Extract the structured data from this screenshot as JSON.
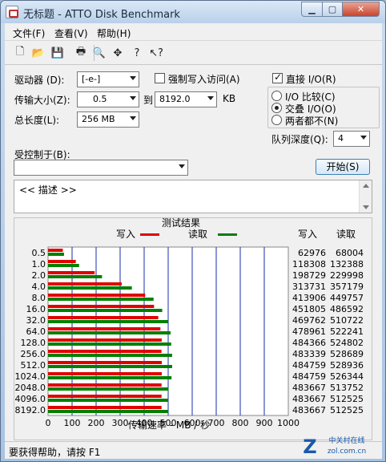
{
  "window": {
    "title": "无标题 - ATTO Disk Benchmark"
  },
  "menu": [
    {
      "label": "文件(F)"
    },
    {
      "label": "查看(V)"
    },
    {
      "label": "帮助(H)"
    }
  ],
  "toolbar": {
    "icons": [
      "new-icon",
      "open-icon",
      "save-icon",
      "print-icon",
      "print-preview-icon",
      "move-icon",
      "help-icon",
      "context-help-icon"
    ]
  },
  "form": {
    "drive_label": "驱动器 (D):",
    "drive_value": "[-e-]",
    "force_write_label": "强制写入访问(A)",
    "transfer_size_label": "传输大小(Z):",
    "transfer_from": "0.5",
    "to_label": "到",
    "transfer_to": "8192.0",
    "kb_label": "KB",
    "total_length_label": "总长度(L):",
    "total_length_value": "256 MB",
    "direct_io_label": "直接 I/O(R)",
    "io_compare_label": "I/O 比较(C)",
    "overlap_io_label": "交叠 I/O(O)",
    "neither_label": "两者都不(N)",
    "queue_depth_label": "队列深度(Q):",
    "queue_depth_value": "4",
    "controlled_by_label": "受控制于(B):",
    "controlled_by_value": "",
    "start_button": "开始(S)",
    "description": "<< 描述 >>"
  },
  "chart_data": {
    "type": "bar",
    "title": "测试结果",
    "legend": {
      "write": "写入",
      "read": "读取",
      "position": "top"
    },
    "xlabel": "传输速率 - MB / 秒",
    "xlim": [
      0,
      1000
    ],
    "xticks": [
      "0",
      "100",
      "200",
      "300",
      "400",
      "500",
      "600",
      "700",
      "800",
      "900",
      "1000"
    ],
    "categories": [
      "0.5",
      "1.0",
      "2.0",
      "4.0",
      "8.0",
      "16.0",
      "32.0",
      "64.0",
      "128.0",
      "256.0",
      "512.0",
      "1024.0",
      "2048.0",
      "4096.0",
      "8192.0"
    ],
    "series": [
      {
        "name": "写入",
        "color": "#e00000",
        "values": [
          62976,
          118308,
          198729,
          313731,
          413906,
          451805,
          469762,
          478961,
          484366,
          483339,
          484759,
          484759,
          483667,
          483667,
          483667
        ]
      },
      {
        "name": "读取",
        "color": "#008000",
        "values": [
          68004,
          132388,
          229998,
          357179,
          449757,
          486592,
          510722,
          522241,
          524802,
          528689,
          528936,
          526344,
          513752,
          512525,
          512525
        ]
      }
    ],
    "column_headers": {
      "write": "写入",
      "read": "读取"
    },
    "grid": true
  },
  "status": {
    "text": "要获得帮助，请按 F1"
  },
  "watermark": {
    "text": "中关村在线",
    "url_text": "zol.com.cn"
  }
}
